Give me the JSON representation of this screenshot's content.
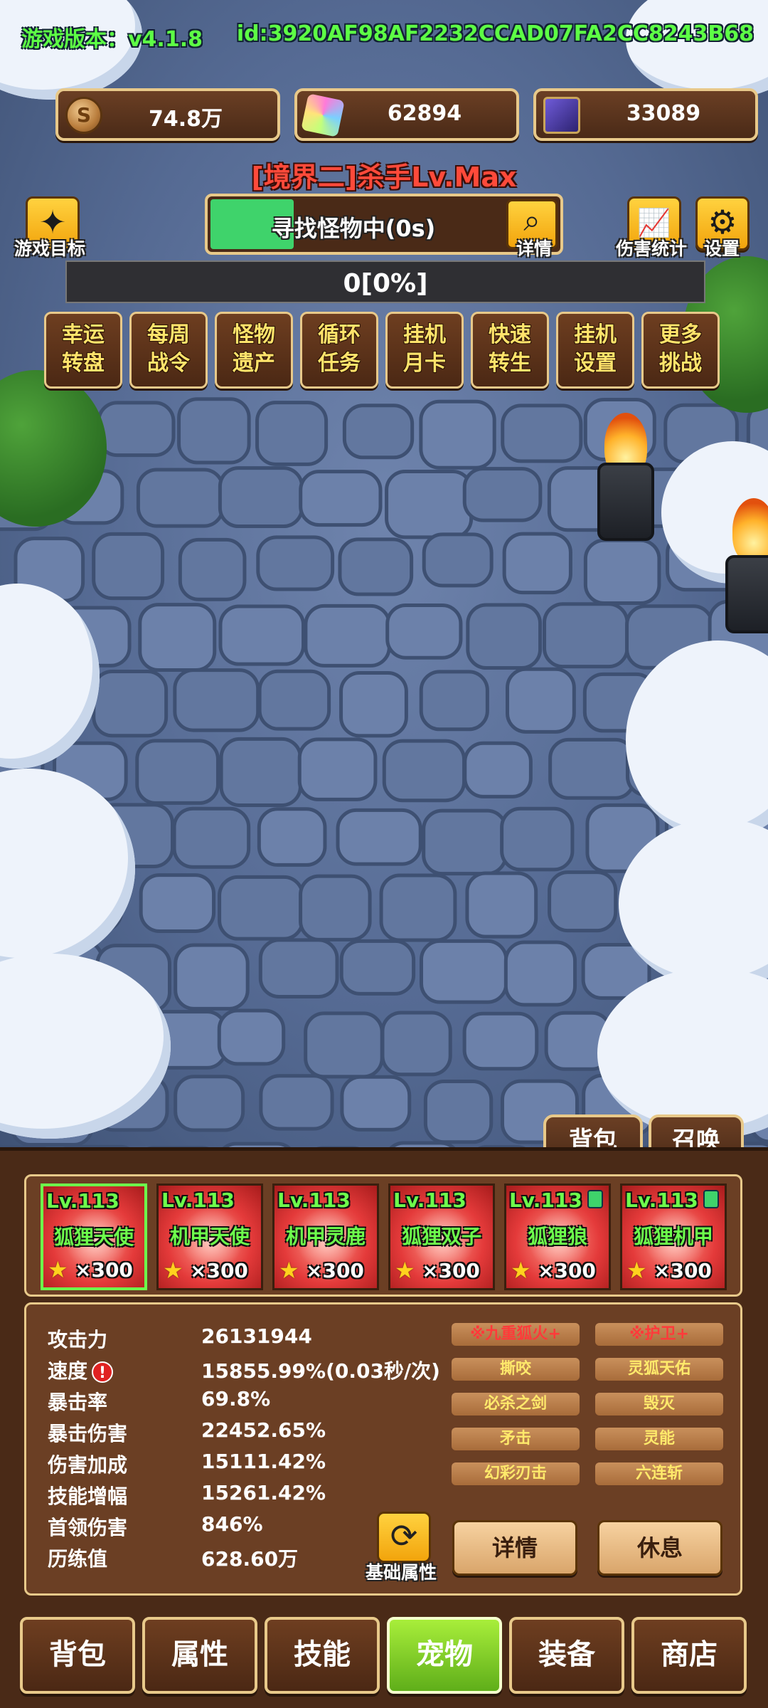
{
  "header": {
    "version_text": "游戏版本：v4.1.8",
    "id_text": "id:3920AF98AF2232CCAD07FA2CC8243B68"
  },
  "resources": [
    {
      "icon": "coin-icon",
      "value": "74.8万"
    },
    {
      "icon": "crystal-icon",
      "value": "62894"
    },
    {
      "icon": "card-icon",
      "value": "33089"
    }
  ],
  "rank_title": "[境界二]杀手Lv.Max",
  "left_button": {
    "icon": "star-icon",
    "label": "游戏目标"
  },
  "search": {
    "text": "寻找怪物中(0s)",
    "detail_label": "详情",
    "fill_fraction": 0.24
  },
  "right_buttons": [
    {
      "icon": "chart-icon",
      "label": "伤害统计"
    },
    {
      "icon": "gear-icon",
      "label": "设置"
    }
  ],
  "progress_text": "0[0%]",
  "features": [
    {
      "line1": "幸运",
      "line2": "转盘"
    },
    {
      "line1": "每周",
      "line2": "战令"
    },
    {
      "line1": "怪物",
      "line2": "遗产"
    },
    {
      "line1": "循环",
      "line2": "任务"
    },
    {
      "line1": "挂机",
      "line2": "月卡"
    },
    {
      "line1": "快速",
      "line2": "转生"
    },
    {
      "line1": "挂机",
      "line2": "设置"
    },
    {
      "line1": "更多",
      "line2": "挑战"
    }
  ],
  "panel_tabs": {
    "bag": "背包",
    "summon": "召唤"
  },
  "pets": [
    {
      "level": "Lv.113",
      "name": "狐狸天使",
      "stars": "×300",
      "locked": false,
      "selected": true
    },
    {
      "level": "Lv.113",
      "name": "机甲天使",
      "stars": "×300",
      "locked": false,
      "selected": false
    },
    {
      "level": "Lv.113",
      "name": "机甲灵鹿",
      "stars": "×300",
      "locked": false,
      "selected": false
    },
    {
      "level": "Lv.113",
      "name": "狐狸双子",
      "stars": "×300",
      "locked": false,
      "selected": false
    },
    {
      "level": "Lv.113",
      "name": "狐狸狼",
      "stars": "×300",
      "locked": true,
      "selected": false
    },
    {
      "level": "Lv.113",
      "name": "狐狸机甲",
      "stars": "×300",
      "locked": true,
      "selected": false
    }
  ],
  "stats": [
    {
      "label": "攻击力",
      "value": "26131944"
    },
    {
      "label": "速度",
      "value": "15855.99%(0.03秒/次)",
      "warning": true
    },
    {
      "label": "暴击率",
      "value": "69.8%"
    },
    {
      "label": "暴击伤害",
      "value": "22452.65%"
    },
    {
      "label": "伤害加成",
      "value": "15111.42%"
    },
    {
      "label": "技能增幅",
      "value": "15261.42%"
    },
    {
      "label": "首领伤害",
      "value": "846%"
    },
    {
      "label": "历练值",
      "value": "628.60万"
    }
  ],
  "skills": [
    {
      "label": "※九重狐火+",
      "highlight": true
    },
    {
      "label": "※护卫+",
      "highlight": true
    },
    {
      "label": "撕咬",
      "highlight": false
    },
    {
      "label": "灵狐天佑",
      "highlight": false
    },
    {
      "label": "必杀之剑",
      "highlight": false
    },
    {
      "label": "毁灭",
      "highlight": false
    },
    {
      "label": "矛击",
      "highlight": false
    },
    {
      "label": "灵能",
      "highlight": false
    },
    {
      "label": "幻彩刃击",
      "highlight": false
    },
    {
      "label": "六连斩",
      "highlight": false
    }
  ],
  "actions": {
    "base_attr_label": "基础属性",
    "detail": "详情",
    "rest": "休息"
  },
  "nav": [
    {
      "label": "背包",
      "active": false
    },
    {
      "label": "属性",
      "active": false
    },
    {
      "label": "技能",
      "active": false
    },
    {
      "label": "宠物",
      "active": true
    },
    {
      "label": "装备",
      "active": false
    },
    {
      "label": "商店",
      "active": false
    }
  ]
}
